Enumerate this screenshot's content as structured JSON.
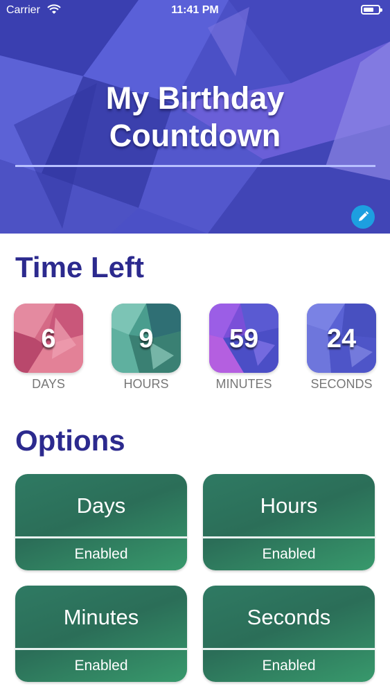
{
  "status_bar": {
    "carrier": "Carrier",
    "time": "11:41 PM"
  },
  "header": {
    "title_line1": "My Birthday",
    "title_line2": "Countdown"
  },
  "time_left": {
    "title": "Time Left",
    "items": [
      {
        "value": "6",
        "label": "DAYS"
      },
      {
        "value": "9",
        "label": "HOURS"
      },
      {
        "value": "59",
        "label": "MINUTES"
      },
      {
        "value": "24",
        "label": "SECONDS"
      }
    ]
  },
  "options": {
    "title": "Options",
    "items": [
      {
        "name": "Days",
        "status": "Enabled"
      },
      {
        "name": "Hours",
        "status": "Enabled"
      },
      {
        "name": "Minutes",
        "status": "Enabled"
      },
      {
        "name": "Seconds",
        "status": "Enabled"
      }
    ]
  },
  "colors": {
    "accent_heading": "#2c2a8e",
    "option_green": "#2f7a63",
    "header_blue": "#4a4fc4",
    "edit_button": "#1d9fe0"
  }
}
